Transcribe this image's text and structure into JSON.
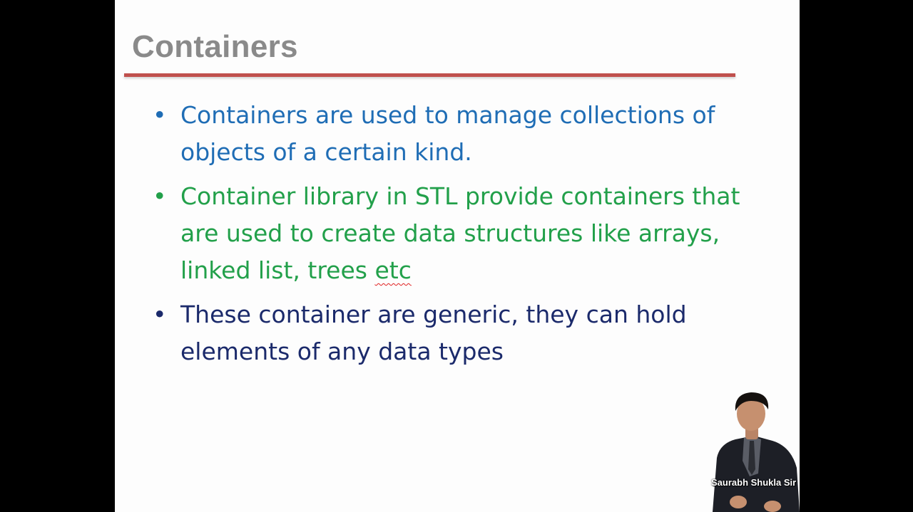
{
  "slide": {
    "title": "Containers",
    "bullets": [
      {
        "text": "Containers are used to manage collections of objects of a certain kind.",
        "color": "#1f6db5"
      },
      {
        "text": "Container library in STL provide containers that are used to create data structures like arrays, linked list, trees ",
        "flagged_word": "etc",
        "color": "#22a04a"
      },
      {
        "text": "These container are generic, they can hold elements of any data types",
        "color": "#1b2a6b"
      }
    ],
    "bullet_glyph": "•",
    "title_rule_color": "#c0504d"
  },
  "presenter": {
    "caption": "Saurabh Shukla Sir"
  }
}
